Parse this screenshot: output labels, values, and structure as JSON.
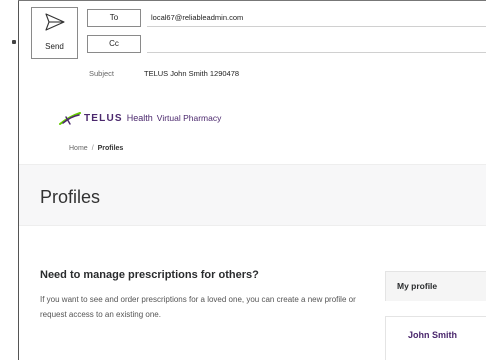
{
  "compose": {
    "send_label": "Send",
    "to_label": "To",
    "cc_label": "Cc",
    "to_value": "local67@reliableadmin.com",
    "cc_value": "",
    "subject_label": "Subject",
    "subject_value": "TELUS John Smith 1290478"
  },
  "brand": {
    "name": "TELUS",
    "health": "Health",
    "product": "Virtual Pharmacy",
    "colors": {
      "primary": "#4b286d",
      "accent": "#66cc00"
    }
  },
  "breadcrumb": {
    "home": "Home",
    "separator": "/",
    "current": "Profiles"
  },
  "page": {
    "title": "Profiles"
  },
  "manage": {
    "heading": "Need to manage prescriptions for others?",
    "text": "If you want to see and order prescriptions for a loved one, you can create a new profile or request access to an existing one."
  },
  "sidebar": {
    "my_profile_label": "My profile",
    "profile_name": "John Smith"
  }
}
